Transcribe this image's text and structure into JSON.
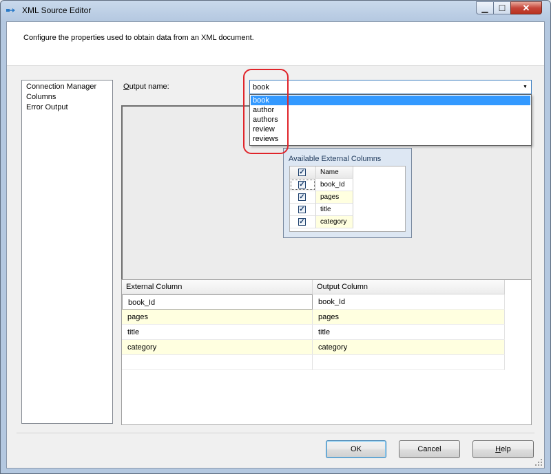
{
  "window": {
    "title": "XML Source Editor"
  },
  "header": {
    "description": "Configure the properties used to obtain data from an XML document."
  },
  "nav": {
    "items": [
      "Connection Manager",
      "Columns",
      "Error Output"
    ]
  },
  "output": {
    "label_prefix": "O",
    "label_rest": "utput name:",
    "selected": "book",
    "options": [
      "book",
      "author",
      "authors",
      "review",
      "reviews"
    ]
  },
  "available": {
    "title": "Available External Columns",
    "header": "Name",
    "columns": [
      "book_Id",
      "pages",
      "title",
      "category"
    ]
  },
  "mapping": {
    "headers": [
      "External Column",
      "Output Column"
    ],
    "rows": [
      [
        "book_Id",
        "book_Id"
      ],
      [
        "pages",
        "pages"
      ],
      [
        "title",
        "title"
      ],
      [
        "category",
        "category"
      ]
    ]
  },
  "buttons": {
    "ok": "OK",
    "cancel": "Cancel",
    "help_first": "H",
    "help_rest": "elp"
  },
  "colors": {
    "selection": "#3399ff",
    "highlight": "#e0242a",
    "alt_row": "#ffffe0"
  }
}
